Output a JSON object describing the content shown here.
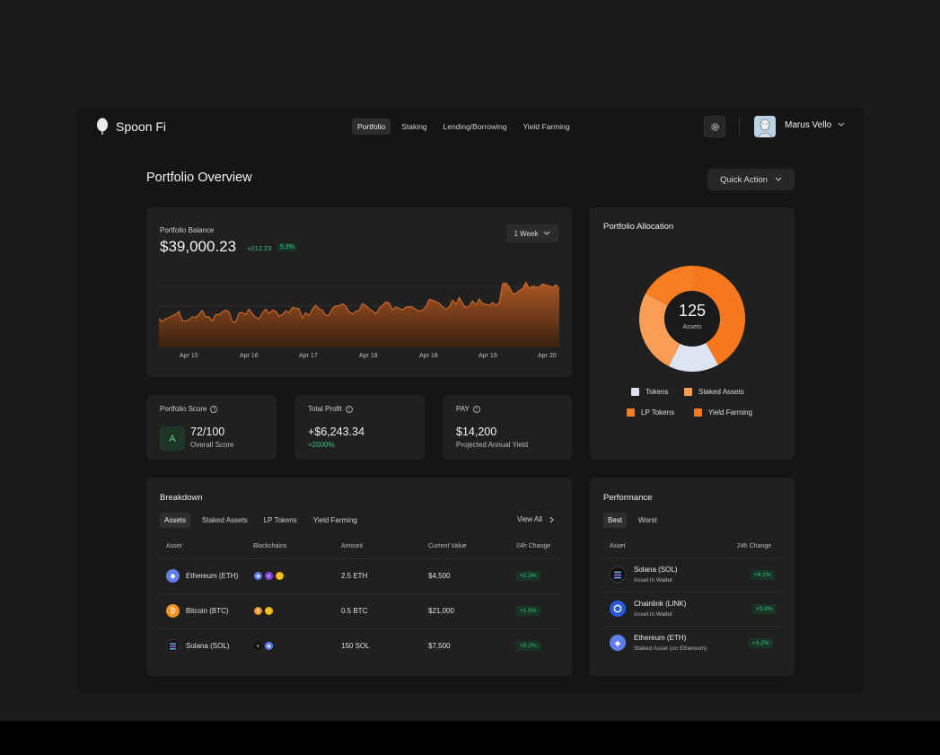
{
  "header": {
    "app_name": "Spoon Fi",
    "nav": [
      "Portfolio",
      "Staking",
      "Lending/Borrowing",
      "Yield Farming"
    ],
    "user_name": "Marus Vello"
  },
  "page": {
    "title": "Portfolio Overview",
    "quick_action": "Quick Action"
  },
  "balance": {
    "label": "Portfolio Balance",
    "value": "$39,000.23",
    "change": "+212.23",
    "change_pct": "5.3%",
    "range": "1 Week",
    "x_ticks": [
      "Apr 15",
      "Apr 16",
      "Apr 17",
      "Apr 18",
      "Apr 18",
      "Apr 19",
      "Apr 20"
    ]
  },
  "stats": {
    "score": {
      "title": "Portfolio Score",
      "grade": "A",
      "value": "72/100",
      "sub": "Overall Score"
    },
    "profit": {
      "title": "Total Profit",
      "value": "+$6,243.34",
      "sub": "+2000%"
    },
    "pay": {
      "title": "PAY",
      "value": "$14,200",
      "sub": "Projected Annual Yield"
    }
  },
  "allocation": {
    "title": "Portfolio Allocation",
    "total": "125",
    "total_label": "Assets",
    "legend": [
      {
        "label": "Tokens",
        "color": "#dde3f3"
      },
      {
        "label": "Staked Assets",
        "color": "#fb9d55"
      },
      {
        "label": "LP Tokens",
        "color": "#f77d22"
      },
      {
        "label": "Yield Farming",
        "color": "#f5781f"
      }
    ]
  },
  "breakdown": {
    "title": "Breakdown",
    "tabs": [
      "Assets",
      "Staked Assets",
      "LP Tokens",
      "Yield Farming"
    ],
    "view_all": "View All",
    "columns": [
      "Asset",
      "Blockchains",
      "Amount",
      "Current Value",
      "24h Change"
    ],
    "rows": [
      {
        "asset": "Ethereum (ETH)",
        "amount": "2.5 ETH",
        "value": "$4,500",
        "change": "+2.3%"
      },
      {
        "asset": "Bitcoin (BTC)",
        "amount": "0.5 BTC",
        "value": "$21,000",
        "change": "+1.5%"
      },
      {
        "asset": "Solana (SOL)",
        "amount": "150 SOL",
        "value": "$7,500",
        "change": "+0.2%"
      }
    ]
  },
  "performance": {
    "title": "Performance",
    "tabs": [
      "Best",
      "Worst"
    ],
    "columns": [
      "Asset",
      "24h Change"
    ],
    "rows": [
      {
        "name": "Solana (SOL)",
        "sub": "Asset in Wallet",
        "change": "+4.1%"
      },
      {
        "name": "Chainlink (LINK)",
        "sub": "Asset in Wallet",
        "change": "+3.8%"
      },
      {
        "name": "Ethereum (ETH)",
        "sub": "Staked Asset (on Ethereum)",
        "change": "+3.2%"
      }
    ]
  }
}
